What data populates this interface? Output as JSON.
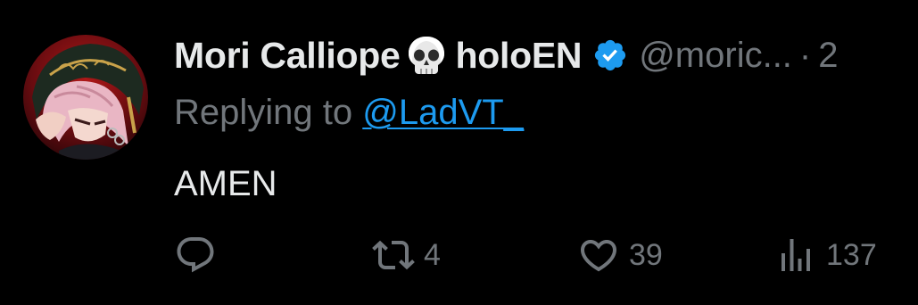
{
  "author": {
    "display_name": "Mori Calliope",
    "emoji_icon": "skull-icon",
    "affiliation": "holoEN",
    "verified_icon": "verified-badge-icon",
    "handle": "@moric...",
    "separator": "·",
    "date_fragment": "2"
  },
  "reply": {
    "prefix": "Replying to ",
    "mention": "@LadVT_"
  },
  "tweet": {
    "text": "AMEN"
  },
  "actions": {
    "reply": {
      "icon": "reply-icon",
      "count": ""
    },
    "retweet": {
      "icon": "retweet-icon",
      "count": "4"
    },
    "like": {
      "icon": "heart-icon",
      "count": "39"
    },
    "views": {
      "icon": "views-chart-icon",
      "count": "137"
    }
  },
  "colors": {
    "background": "#000000",
    "primary_text": "#e7e9ea",
    "secondary_text": "#71767b",
    "link": "#1d9bf0",
    "verified": "#1d9bf0"
  }
}
